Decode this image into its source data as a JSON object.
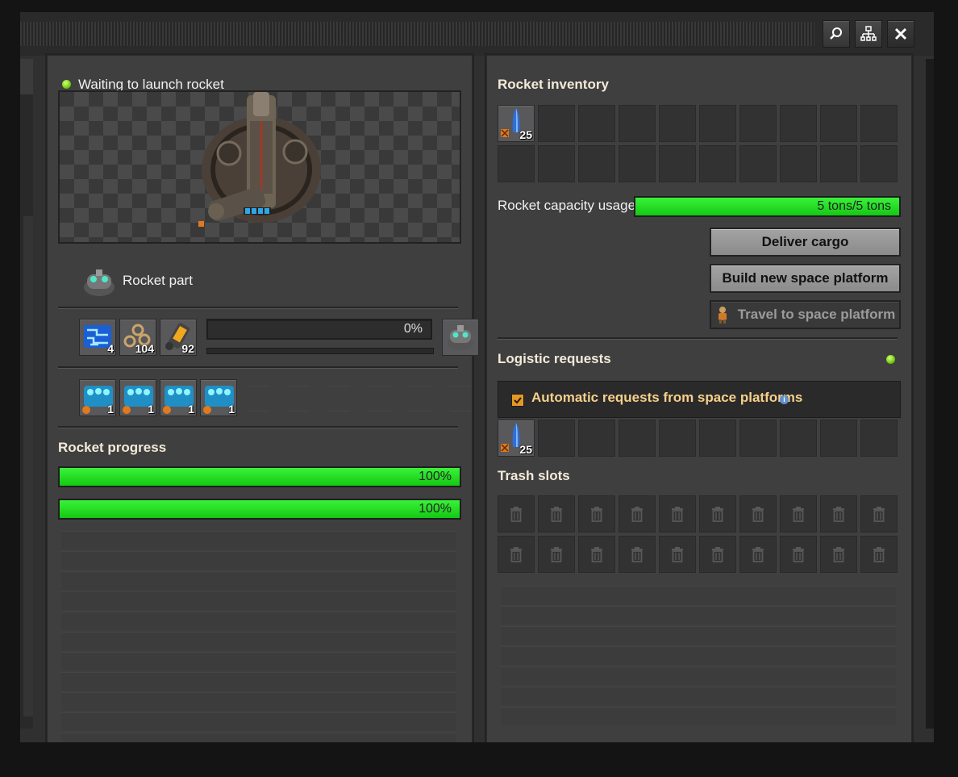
{
  "left": {
    "status_text": "Waiting to launch rocket",
    "recipe_label": "Rocket part",
    "ingredients": [
      {
        "icon": "processing-unit-icon",
        "count": "4"
      },
      {
        "icon": "low-density-structure-icon",
        "count": "104"
      },
      {
        "icon": "rocket-fuel-icon",
        "count": "92"
      }
    ],
    "crafting_progress": {
      "percent_label": "0%",
      "value": 0
    },
    "output_icon": "rocket-part-icon",
    "modules": [
      {
        "icon": "productivity-module-icon",
        "count": "1"
      },
      {
        "icon": "productivity-module-icon",
        "count": "1"
      },
      {
        "icon": "productivity-module-icon",
        "count": "1"
      },
      {
        "icon": "productivity-module-icon",
        "count": "1"
      }
    ],
    "rocket_progress_title": "Rocket progress",
    "rocket_progress": [
      {
        "percent_label": "100%",
        "value": 1.0
      },
      {
        "percent_label": "100%",
        "value": 1.0
      }
    ]
  },
  "right": {
    "inventory_title": "Rocket inventory",
    "inventory": [
      {
        "icon": "cargo-rocket-item-icon",
        "count": "25"
      }
    ],
    "capacity_label": "Rocket capacity usage",
    "capacity_value_label": "5 tons/5 tons",
    "capacity_value": 1.0,
    "buttons": {
      "deliver_cargo": "Deliver cargo",
      "build_platform": "Build new space platform",
      "travel_platform": "Travel to space platform"
    },
    "logistic_title": "Logistic requests",
    "auto_requests_label": "Automatic requests from space platforms",
    "auto_requests_checked": true,
    "requests": [
      {
        "icon": "cargo-rocket-item-icon",
        "count": "25"
      }
    ],
    "trash_title": "Trash slots"
  },
  "colors": {
    "accent_green": "#14c814",
    "status_dot": "#7bd018",
    "checkbox": "#e39827"
  }
}
